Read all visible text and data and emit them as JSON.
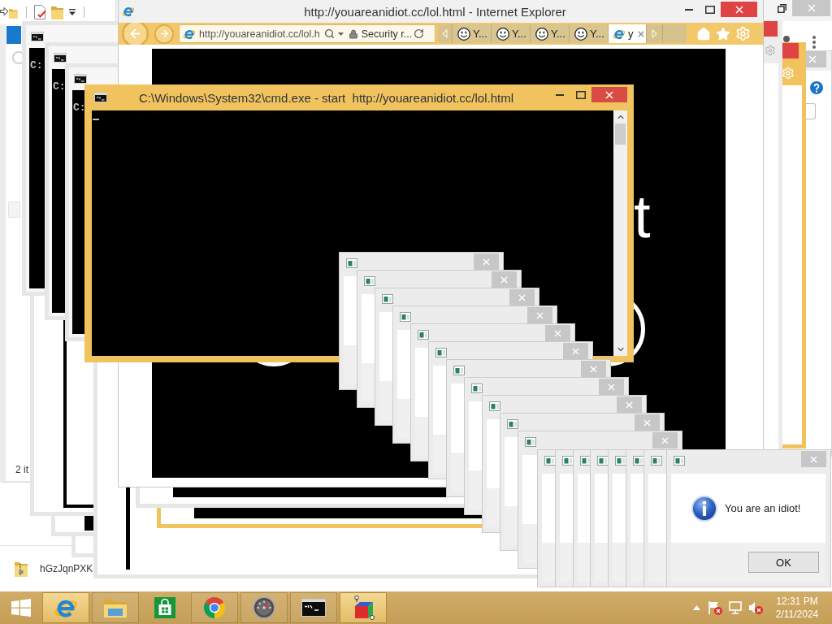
{
  "windows_behind": [
    {
      "kind": "maximized_browser"
    },
    {
      "kind": "explorer",
      "status": "2 it"
    },
    {
      "kind": "file_list",
      "file": "hGzJqnPXK"
    },
    {
      "kind": "browser_frame",
      "color": "#e6e6e6"
    },
    {
      "kind": "browser_frame",
      "color": "#e6e6e6"
    },
    {
      "kind": "browser_frame",
      "color": "#e6e6e6"
    },
    {
      "kind": "console",
      "prompt": "C:"
    },
    {
      "kind": "console",
      "prompt": "C:"
    },
    {
      "kind": "console",
      "prompt": "C:"
    },
    {
      "kind": "browser_frame",
      "color": "#e6e6e6"
    },
    {
      "kind": "browser_frame",
      "color": "#f0c35e"
    },
    {
      "kind": "browser_frame",
      "color": "#e6e6e6"
    },
    {
      "kind": "help_window"
    },
    {
      "kind": "toolbar_window",
      "color": "#f0c35e"
    },
    {
      "kind": "toolbar_window",
      "color": "#ececec"
    }
  ],
  "browser": {
    "title": "http://youareanidiot.cc/lol.html - Internet Explorer",
    "address": "http://youareanidiot.cc/lol.h",
    "security": "Security r...",
    "tabs": [
      {
        "label": "Y...",
        "selected": false
      },
      {
        "label": "Y...",
        "selected": false
      },
      {
        "label": "Y...",
        "selected": false
      },
      {
        "label": "Y...",
        "selected": false
      },
      {
        "label": "y",
        "selected": true
      }
    ],
    "page_text": "t"
  },
  "console": {
    "title": "C:\\Windows\\System32\\cmd.exe - start  http://youareanidiot.cc/lol.html"
  },
  "message_boxes": [
    {
      "kind": "cascade"
    },
    {
      "kind": "cascade"
    },
    {
      "kind": "cascade"
    },
    {
      "kind": "cascade"
    },
    {
      "kind": "cascade"
    },
    {
      "kind": "cascade"
    },
    {
      "kind": "cascade"
    },
    {
      "kind": "cascade"
    },
    {
      "kind": "cascade"
    },
    {
      "kind": "cascade"
    },
    {
      "kind": "cascade"
    },
    {
      "kind": "row"
    },
    {
      "kind": "row"
    },
    {
      "kind": "row"
    },
    {
      "kind": "row"
    },
    {
      "kind": "row"
    },
    {
      "kind": "row"
    },
    {
      "kind": "row"
    },
    {
      "kind": "alert",
      "message": "You are an idiot!",
      "button": "OK"
    }
  ],
  "taskbar": {
    "apps": [
      {
        "kind": "e_browser",
        "highlighted": true,
        "running": true
      },
      {
        "kind": "folder",
        "highlighted": false,
        "running": true
      },
      {
        "kind": "store",
        "highlighted": false,
        "running": false
      },
      {
        "kind": "round_browser",
        "highlighted": false,
        "running": true
      },
      {
        "kind": "gauge",
        "highlighted": false,
        "running": true
      },
      {
        "kind": "console",
        "highlighted": false,
        "running": true
      },
      {
        "kind": "cube",
        "highlighted": true,
        "running": true
      }
    ],
    "tray": [
      {
        "kind": "caret"
      },
      {
        "kind": "flag"
      },
      {
        "kind": "network"
      },
      {
        "kind": "volume"
      }
    ],
    "clock": {
      "time": "12:31 PM",
      "date": "2/11/2024"
    }
  }
}
